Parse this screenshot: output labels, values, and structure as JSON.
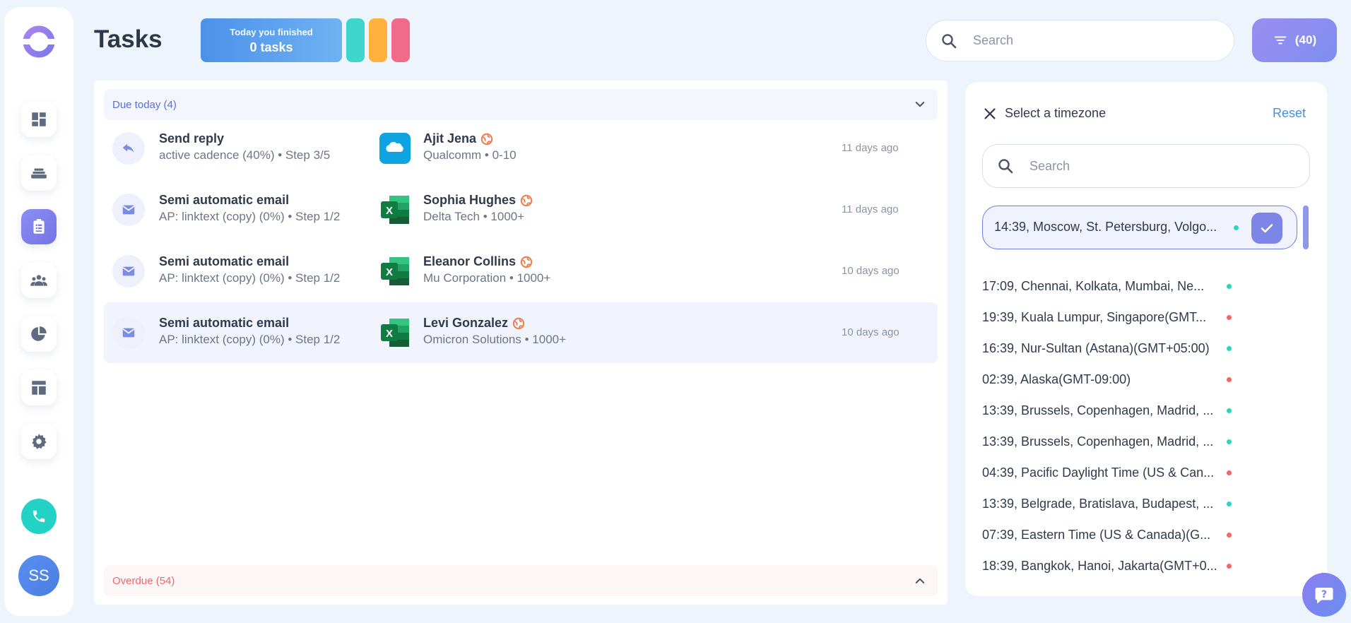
{
  "header": {
    "title": "Tasks",
    "finished_line1": "Today you finished",
    "finished_line2": "0 tasks",
    "pill_colors": [
      "#3ed6cc",
      "#ffb13d",
      "#f06a8a"
    ],
    "search_placeholder": "Search",
    "filter_label": "(40)"
  },
  "sidebar": {
    "items": [
      {
        "name": "dashboard-icon",
        "active": false
      },
      {
        "name": "layers-icon",
        "active": false
      },
      {
        "name": "clipboard-icon",
        "active": true
      },
      {
        "name": "people-icon",
        "active": false
      },
      {
        "name": "pie-chart-icon",
        "active": false
      },
      {
        "name": "layout-icon",
        "active": false
      },
      {
        "name": "gear-icon",
        "active": false
      }
    ],
    "avatar_initials": "SS"
  },
  "sections": {
    "due_label": "Due today (4)",
    "overdue_label": "Overdue (54)"
  },
  "tasks": [
    {
      "icon": "reply-icon",
      "title": "Send reply",
      "subtitle": "active cadence (40%) • Step 3/5",
      "source": "salesforce-icon",
      "contact": "Ajit Jena",
      "company": "Qualcomm • 0-10",
      "time": "11 days ago"
    },
    {
      "icon": "mail-icon",
      "title": "Semi automatic email",
      "subtitle": "AP: linktext (copy) (0%) • Step 1/2",
      "source": "excel-icon",
      "contact": "Sophia Hughes",
      "company": "Delta Tech • 1000+",
      "time": "11 days ago"
    },
    {
      "icon": "mail-icon",
      "title": "Semi automatic email",
      "subtitle": "AP: linktext (copy) (0%) • Step 1/2",
      "source": "excel-icon",
      "contact": "Eleanor Collins",
      "company": "Mu Corporation • 1000+",
      "time": "10 days ago"
    },
    {
      "icon": "mail-icon",
      "title": "Semi automatic email",
      "subtitle": "AP: linktext (copy) (0%) • Step 1/2",
      "source": "excel-icon",
      "contact": "Levi Gonzalez",
      "company": "Omicron Solutions • 1000+",
      "time": "10 days ago"
    }
  ],
  "timezone": {
    "title": "Select a timezone",
    "reset": "Reset",
    "search_placeholder": "Search",
    "selected": {
      "label": "14:39, Moscow, St. Petersburg, Volgo...",
      "status": "green"
    },
    "items": [
      {
        "label": "17:09, Chennai, Kolkata, Mumbai, Ne...",
        "status": "green"
      },
      {
        "label": "19:39, Kuala Lumpur, Singapore(GMT...",
        "status": "red"
      },
      {
        "label": "16:39, Nur-Sultan (Astana)(GMT+05:00)",
        "status": "green"
      },
      {
        "label": "02:39, Alaska(GMT-09:00)",
        "status": "red"
      },
      {
        "label": "13:39, Brussels, Copenhagen, Madrid, ...",
        "status": "green"
      },
      {
        "label": "13:39, Brussels, Copenhagen, Madrid, ...",
        "status": "green"
      },
      {
        "label": "04:39, Pacific Daylight Time (US & Can...",
        "status": "red"
      },
      {
        "label": "13:39, Belgrade, Bratislava, Budapest, ...",
        "status": "green"
      },
      {
        "label": "07:39, Eastern Time (US & Canada)(G...",
        "status": "red"
      },
      {
        "label": "18:39, Bangkok, Hanoi, Jakarta(GMT+0...",
        "status": "red"
      }
    ]
  }
}
